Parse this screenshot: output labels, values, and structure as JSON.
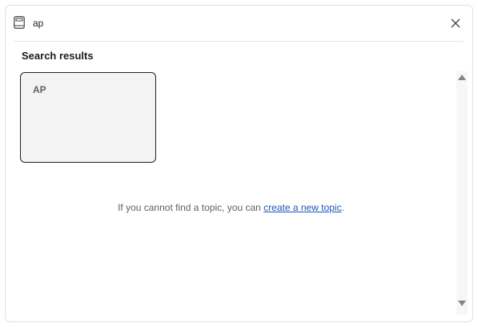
{
  "search": {
    "value": "ap",
    "icon": "notebook-icon"
  },
  "close_icon": "close-icon",
  "results": {
    "heading": "Search results",
    "items": [
      {
        "label": "AP"
      }
    ]
  },
  "hint": {
    "prefix": "If you cannot find a topic, you can ",
    "link": "create a new topic",
    "suffix": "."
  },
  "colors": {
    "link": "#1f57b6",
    "card_background": "#f3f3f3",
    "card_border": "#222222"
  }
}
